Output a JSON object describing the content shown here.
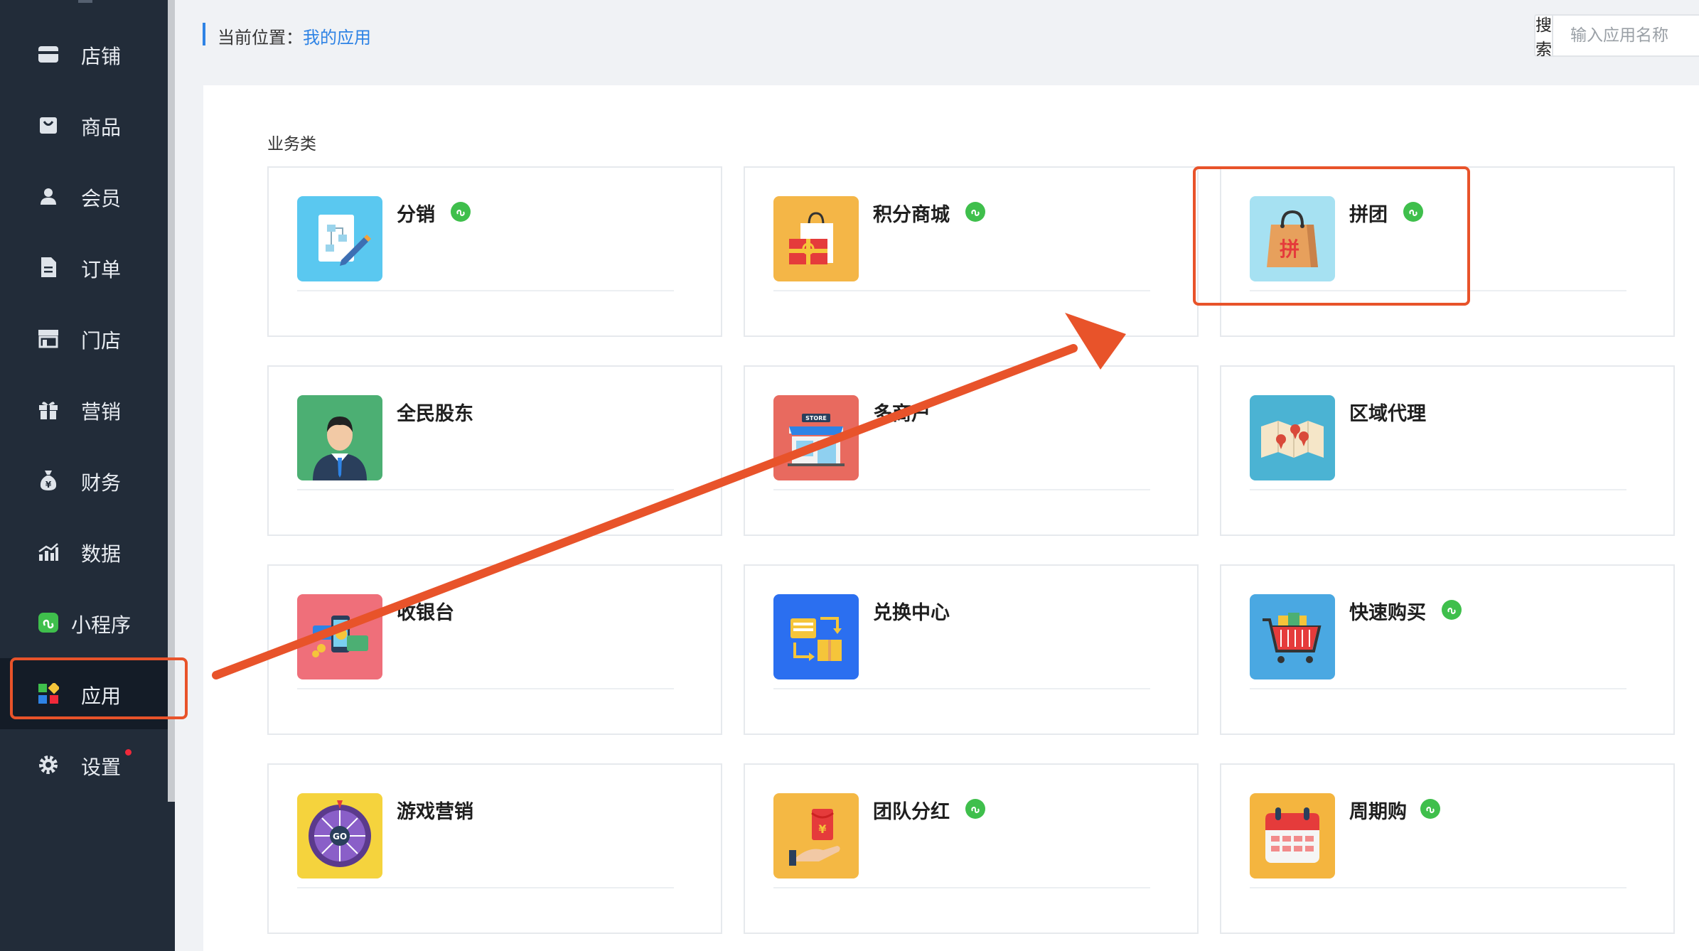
{
  "sidebar": {
    "items": [
      {
        "label": "店铺",
        "icon": "store-icon"
      },
      {
        "label": "商品",
        "icon": "bag-icon"
      },
      {
        "label": "会员",
        "icon": "user-icon"
      },
      {
        "label": "订单",
        "icon": "document-icon"
      },
      {
        "label": "门店",
        "icon": "shop-icon"
      },
      {
        "label": "营销",
        "icon": "gift-icon"
      },
      {
        "label": "财务",
        "icon": "money-bag-icon"
      },
      {
        "label": "数据",
        "icon": "bar-chart-icon"
      },
      {
        "label": "小程序",
        "icon": "mini-program-icon"
      },
      {
        "label": "应用",
        "icon": "apps-icon",
        "active": true
      },
      {
        "label": "设置",
        "icon": "gear-icon",
        "has_dot": true
      }
    ]
  },
  "breadcrumb": {
    "prefix": "当前位置：",
    "current": "我的应用"
  },
  "search": {
    "button_label": "搜索",
    "placeholder": "输入应用名称"
  },
  "section": {
    "title": "业务类"
  },
  "apps": [
    {
      "name": "分销",
      "badge": true,
      "icon": "distribution-icon",
      "color": "#5ac8f0"
    },
    {
      "name": "积分商城",
      "badge": true,
      "icon": "points-mall-icon",
      "color": "#f4b647"
    },
    {
      "name": "拼团",
      "badge": true,
      "icon": "group-buy-icon",
      "color": "#a6e1f2",
      "icon_text": "拼"
    },
    {
      "name": "全民股东",
      "badge": false,
      "icon": "shareholder-icon",
      "color": "#4caf73"
    },
    {
      "name": "多商户",
      "badge": false,
      "icon": "multi-store-icon",
      "color": "#e86a5f",
      "icon_text": "STORE"
    },
    {
      "name": "区域代理",
      "badge": false,
      "icon": "map-icon",
      "color": "#4bb3d3"
    },
    {
      "name": "收银台",
      "badge": false,
      "icon": "cashier-icon",
      "color": "#ef6f7a"
    },
    {
      "name": "兑换中心",
      "badge": false,
      "icon": "exchange-icon",
      "color": "#2b6ff0"
    },
    {
      "name": "快速购买",
      "badge": true,
      "icon": "cart-icon",
      "color": "#4aa8e2"
    },
    {
      "name": "游戏营销",
      "badge": false,
      "icon": "wheel-icon",
      "color": "#f5d33d",
      "icon_text": "GO"
    },
    {
      "name": "团队分红",
      "badge": true,
      "icon": "red-envelope-icon",
      "color": "#f4b844",
      "icon_text": "¥"
    },
    {
      "name": "周期购",
      "badge": true,
      "icon": "calendar-icon",
      "color": "#f4b53f"
    }
  ],
  "colors": {
    "sidebar_bg": "#222c39",
    "accent": "#2e83e5",
    "highlight": "#e8532a",
    "badge": "#3fbf4c"
  }
}
